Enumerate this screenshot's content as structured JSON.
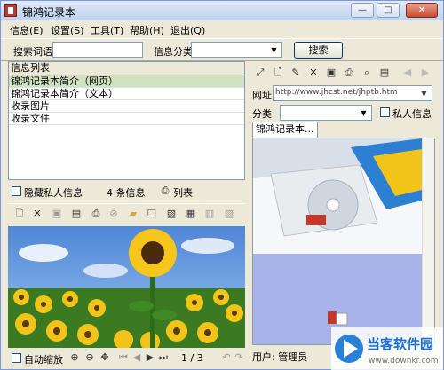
{
  "window": {
    "title": "锦鸿记录本"
  },
  "menu": [
    "信息(E)",
    "设置(S)",
    "工具(T)",
    "帮助(H)",
    "退出(Q)"
  ],
  "search": {
    "keyword_label": "搜索词语",
    "keyword_value": "",
    "category_label": "信息分类",
    "category_value": "",
    "button": "搜索"
  },
  "list": {
    "header": "信息列表",
    "items": [
      "锦鸿记录本简介（网页）",
      "锦鸿记录本简介（文本）",
      "收录图片",
      "收录文件"
    ],
    "selected_index": 0
  },
  "left_status": {
    "hide_private_label": "隐藏私人信息",
    "count": "4 条信息",
    "list_button": "列表"
  },
  "image_panel": {
    "auto_zoom_label": "自动缩放",
    "page": "1 / 3"
  },
  "right": {
    "url_label": "网址",
    "url_value": "http://www.jhcst.net/jhptb.htm",
    "category_label": "分类",
    "category_value": "",
    "private_label": "私人信息",
    "tab_label": "锦鸿记录本...",
    "user_status": "用户: 管理员"
  },
  "watermark": {
    "brand": "当客软件园",
    "url": "www.downkr.com"
  },
  "colors": {
    "selected_row": "#cfe3c0",
    "title_bg": "#dfe9f7",
    "chrome": "#ece9d8"
  }
}
